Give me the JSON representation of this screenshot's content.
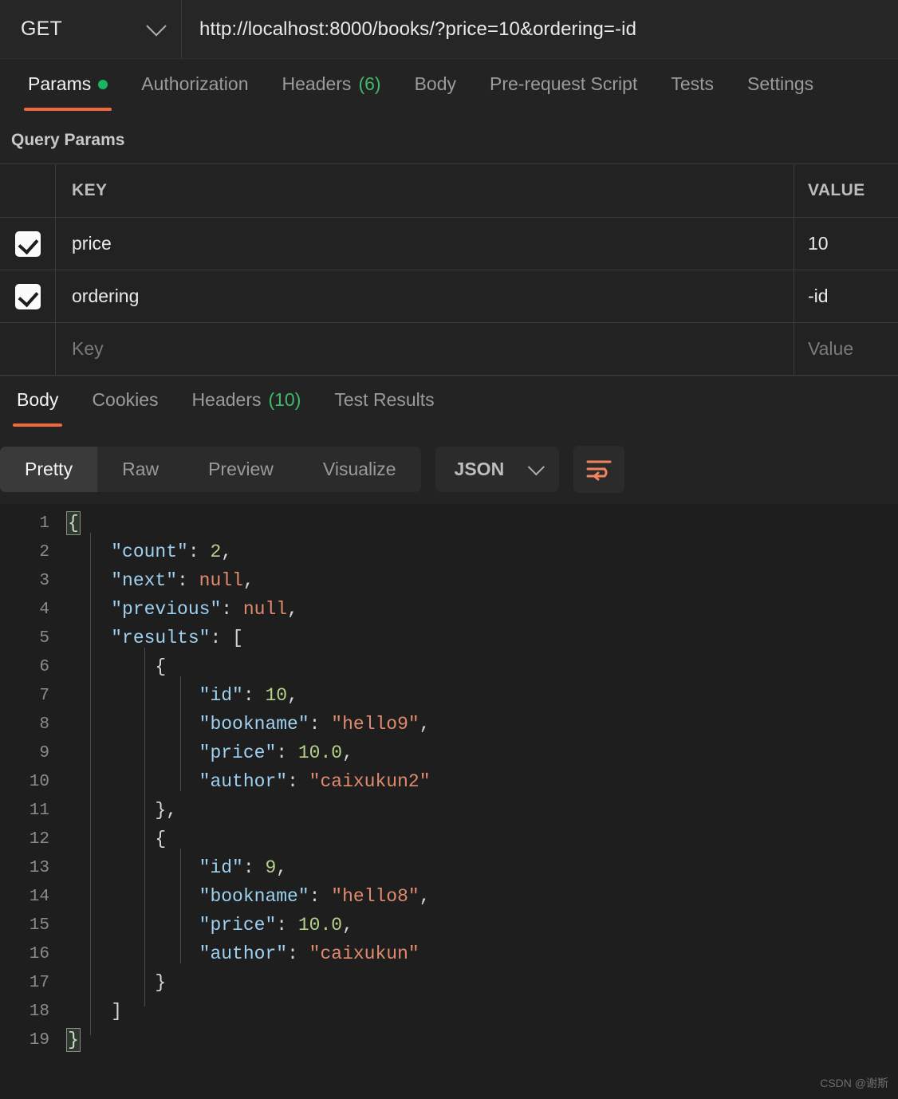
{
  "request": {
    "method": "GET",
    "method_icon": "chevron-down-icon",
    "url": "http://localhost:8000/books/?price=10&ordering=-id"
  },
  "request_tabs": [
    {
      "label": "Params",
      "badge": "",
      "dot": true,
      "active": true
    },
    {
      "label": "Authorization",
      "badge": "",
      "dot": false,
      "active": false
    },
    {
      "label": "Headers",
      "badge": "(6)",
      "dot": false,
      "active": false
    },
    {
      "label": "Body",
      "badge": "",
      "dot": false,
      "active": false
    },
    {
      "label": "Pre-request Script",
      "badge": "",
      "dot": false,
      "active": false
    },
    {
      "label": "Tests",
      "badge": "",
      "dot": false,
      "active": false
    },
    {
      "label": "Settings",
      "badge": "",
      "dot": false,
      "active": false
    }
  ],
  "query_params": {
    "title": "Query Params",
    "columns": {
      "key": "KEY",
      "value": "VALUE"
    },
    "rows": [
      {
        "checked": true,
        "key": "price",
        "value": "10"
      },
      {
        "checked": true,
        "key": "ordering",
        "value": "-id"
      }
    ],
    "new_row": {
      "key_placeholder": "Key",
      "value_placeholder": "Value"
    }
  },
  "response_tabs": [
    {
      "label": "Body",
      "badge": "",
      "active": true
    },
    {
      "label": "Cookies",
      "badge": "",
      "active": false
    },
    {
      "label": "Headers",
      "badge": "(10)",
      "active": false
    },
    {
      "label": "Test Results",
      "badge": "",
      "active": false
    }
  ],
  "format_bar": {
    "views": [
      {
        "label": "Pretty",
        "active": true
      },
      {
        "label": "Raw",
        "active": false
      },
      {
        "label": "Preview",
        "active": false
      },
      {
        "label": "Visualize",
        "active": false
      }
    ],
    "language": "JSON",
    "language_icon": "chevron-down-icon",
    "wrap_icon": "word-wrap-icon"
  },
  "response_body": {
    "language": "json",
    "lines": [
      {
        "n": "1",
        "tokens": [
          {
            "t": "{",
            "c": "p",
            "hl": true
          }
        ]
      },
      {
        "n": "2",
        "tokens": [
          {
            "t": "    ",
            "c": "p"
          },
          {
            "t": "\"count\"",
            "c": "k"
          },
          {
            "t": ": ",
            "c": "p"
          },
          {
            "t": "2",
            "c": "n"
          },
          {
            "t": ",",
            "c": "p"
          }
        ]
      },
      {
        "n": "3",
        "tokens": [
          {
            "t": "    ",
            "c": "p"
          },
          {
            "t": "\"next\"",
            "c": "k"
          },
          {
            "t": ": ",
            "c": "p"
          },
          {
            "t": "null",
            "c": "nl"
          },
          {
            "t": ",",
            "c": "p"
          }
        ]
      },
      {
        "n": "4",
        "tokens": [
          {
            "t": "    ",
            "c": "p"
          },
          {
            "t": "\"previous\"",
            "c": "k"
          },
          {
            "t": ": ",
            "c": "p"
          },
          {
            "t": "null",
            "c": "nl"
          },
          {
            "t": ",",
            "c": "p"
          }
        ]
      },
      {
        "n": "5",
        "tokens": [
          {
            "t": "    ",
            "c": "p"
          },
          {
            "t": "\"results\"",
            "c": "k"
          },
          {
            "t": ": ",
            "c": "p"
          },
          {
            "t": "[",
            "c": "p"
          }
        ]
      },
      {
        "n": "6",
        "tokens": [
          {
            "t": "        ",
            "c": "p"
          },
          {
            "t": "{",
            "c": "p"
          }
        ]
      },
      {
        "n": "7",
        "tokens": [
          {
            "t": "            ",
            "c": "p"
          },
          {
            "t": "\"id\"",
            "c": "k"
          },
          {
            "t": ": ",
            "c": "p"
          },
          {
            "t": "10",
            "c": "n"
          },
          {
            "t": ",",
            "c": "p"
          }
        ]
      },
      {
        "n": "8",
        "tokens": [
          {
            "t": "            ",
            "c": "p"
          },
          {
            "t": "\"bookname\"",
            "c": "k"
          },
          {
            "t": ": ",
            "c": "p"
          },
          {
            "t": "\"hello9\"",
            "c": "s"
          },
          {
            "t": ",",
            "c": "p"
          }
        ]
      },
      {
        "n": "9",
        "tokens": [
          {
            "t": "            ",
            "c": "p"
          },
          {
            "t": "\"price\"",
            "c": "k"
          },
          {
            "t": ": ",
            "c": "p"
          },
          {
            "t": "10.0",
            "c": "n"
          },
          {
            "t": ",",
            "c": "p"
          }
        ]
      },
      {
        "n": "10",
        "tokens": [
          {
            "t": "            ",
            "c": "p"
          },
          {
            "t": "\"author\"",
            "c": "k"
          },
          {
            "t": ": ",
            "c": "p"
          },
          {
            "t": "\"caixukun2\"",
            "c": "s"
          }
        ]
      },
      {
        "n": "11",
        "tokens": [
          {
            "t": "        ",
            "c": "p"
          },
          {
            "t": "},",
            "c": "p"
          }
        ]
      },
      {
        "n": "12",
        "tokens": [
          {
            "t": "        ",
            "c": "p"
          },
          {
            "t": "{",
            "c": "p"
          }
        ]
      },
      {
        "n": "13",
        "tokens": [
          {
            "t": "            ",
            "c": "p"
          },
          {
            "t": "\"id\"",
            "c": "k"
          },
          {
            "t": ": ",
            "c": "p"
          },
          {
            "t": "9",
            "c": "n"
          },
          {
            "t": ",",
            "c": "p"
          }
        ]
      },
      {
        "n": "14",
        "tokens": [
          {
            "t": "            ",
            "c": "p"
          },
          {
            "t": "\"bookname\"",
            "c": "k"
          },
          {
            "t": ": ",
            "c": "p"
          },
          {
            "t": "\"hello8\"",
            "c": "s"
          },
          {
            "t": ",",
            "c": "p"
          }
        ]
      },
      {
        "n": "15",
        "tokens": [
          {
            "t": "            ",
            "c": "p"
          },
          {
            "t": "\"price\"",
            "c": "k"
          },
          {
            "t": ": ",
            "c": "p"
          },
          {
            "t": "10.0",
            "c": "n"
          },
          {
            "t": ",",
            "c": "p"
          }
        ]
      },
      {
        "n": "16",
        "tokens": [
          {
            "t": "            ",
            "c": "p"
          },
          {
            "t": "\"author\"",
            "c": "k"
          },
          {
            "t": ": ",
            "c": "p"
          },
          {
            "t": "\"caixukun\"",
            "c": "s"
          }
        ]
      },
      {
        "n": "17",
        "tokens": [
          {
            "t": "        ",
            "c": "p"
          },
          {
            "t": "}",
            "c": "p"
          }
        ]
      },
      {
        "n": "18",
        "tokens": [
          {
            "t": "    ",
            "c": "p"
          },
          {
            "t": "]",
            "c": "p"
          }
        ]
      },
      {
        "n": "19",
        "tokens": [
          {
            "t": "}",
            "c": "p",
            "hl": true
          }
        ]
      }
    ]
  },
  "watermark": "CSDN @谢斯",
  "colors": {
    "accent_orange": "#f2683c",
    "status_green": "#19b562",
    "badge_green": "#3fba6a",
    "json_key": "#9ed0f0",
    "json_string": "#e08b6d",
    "json_number": "#b8d18a",
    "json_null": "#e08b6d",
    "bg": "#1e1e1e",
    "panel_bg": "#232323"
  }
}
